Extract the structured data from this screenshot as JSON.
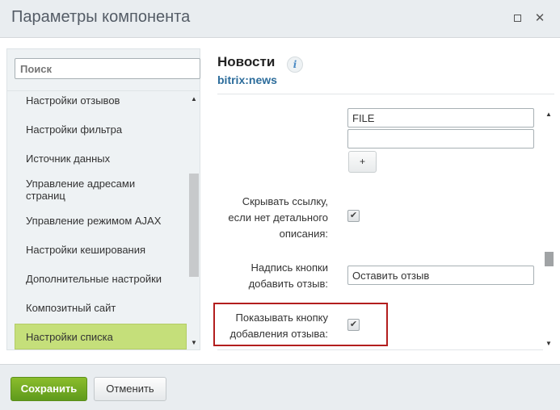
{
  "window": {
    "title": "Параметры компонента",
    "maximize_icon": "maximize-icon",
    "close_icon": "close-icon",
    "close_glyph": "✕"
  },
  "sidebar": {
    "search_placeholder": "Поиск",
    "items": [
      {
        "label": "Настройки отзывов"
      },
      {
        "label": "Настройки фильтра"
      },
      {
        "label": "Источник данных"
      },
      {
        "label": "Управление адресами страниц"
      },
      {
        "label": "Управление режимом AJAX"
      },
      {
        "label": "Настройки кеширования"
      },
      {
        "label": "Дополнительные настройки"
      },
      {
        "label": "Композитный сайт"
      },
      {
        "label": "Настройки списка",
        "active": true
      }
    ],
    "scroll_up": "▲",
    "scroll_down": "▼"
  },
  "component": {
    "title": "Новости",
    "info_glyph": "i",
    "code": "bitrix:news"
  },
  "settings": {
    "file_field_value": "FILE",
    "empty_field_value": "",
    "add_button_label": "+",
    "hide_link_label": "Скрывать ссылку, если нет детального описания:",
    "hide_link_checked": true,
    "add_review_label": "Надпись кнопки добавить отзыв:",
    "add_review_value": "Оставить отзыв",
    "show_button_label": "Показывать кнопку добавления отзыва:",
    "show_button_checked": true,
    "check_glyph": "✔",
    "scroll_up": "▲",
    "scroll_down": "▼"
  },
  "footer": {
    "save_label": "Сохранить",
    "cancel_label": "Отменить"
  },
  "colors": {
    "accent_green": "#6fa723",
    "active_item": "#c5df7a",
    "highlight_border": "#b31e1e",
    "link_blue": "#2c6c9b"
  }
}
